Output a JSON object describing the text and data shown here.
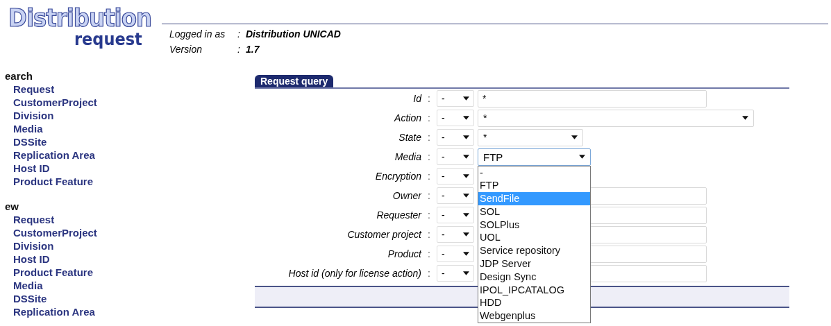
{
  "logo": {
    "title": "Distribution",
    "subtitle": "request"
  },
  "session": [
    {
      "label": "Logged in as",
      "separator": ":",
      "value": "Distribution UNICAD"
    },
    {
      "label": "Version",
      "separator": ":",
      "value": "1.7"
    }
  ],
  "sidebar": {
    "sections": [
      {
        "heading": "earch",
        "items": [
          "Request",
          "CustomerProject",
          "Division",
          "Media",
          "DSSite",
          "Replication Area",
          "Host ID",
          "Product Feature"
        ]
      },
      {
        "heading": "ew",
        "items": [
          "Request",
          "CustomerProject",
          "Division",
          "Host ID",
          "Product Feature",
          "Media",
          "DSSite",
          "Replication Area"
        ]
      }
    ]
  },
  "query": {
    "tab": "Request query",
    "rows": [
      {
        "label": "Id",
        "separator": ":",
        "operator": "-",
        "kind": "text",
        "value": "*"
      },
      {
        "label": "Action",
        "separator": ":",
        "operator": "-",
        "kind": "select",
        "value": "*"
      },
      {
        "label": "State",
        "separator": ":",
        "operator": "-",
        "kind": "select",
        "value": "*"
      },
      {
        "label": "Media",
        "separator": ":",
        "operator": "-",
        "kind": "select",
        "value": "FTP",
        "focused": true,
        "options": [
          {
            "label": "-",
            "highlighted": false
          },
          {
            "label": "FTP",
            "highlighted": false
          },
          {
            "label": "SendFile",
            "highlighted": true
          },
          {
            "label": "SOL",
            "highlighted": false
          },
          {
            "label": "SOLPlus",
            "highlighted": false
          },
          {
            "label": "UOL",
            "highlighted": false
          },
          {
            "label": "Service repository",
            "highlighted": false
          },
          {
            "label": "JDP Server",
            "highlighted": false
          },
          {
            "label": "Design Sync",
            "highlighted": false
          },
          {
            "label": "IPOL_IPCATALOG",
            "highlighted": false
          },
          {
            "label": "HDD",
            "highlighted": false
          },
          {
            "label": "Webgenplus",
            "highlighted": false
          }
        ]
      },
      {
        "label": "Encryption",
        "separator": ":",
        "operator": "-",
        "kind": "none"
      },
      {
        "label": "Owner",
        "separator": ":",
        "operator": "-",
        "kind": "text"
      },
      {
        "label": "Requester",
        "separator": ":",
        "operator": "-",
        "kind": "text"
      },
      {
        "label": "Customer project",
        "separator": ":",
        "operator": "-",
        "kind": "text"
      },
      {
        "label": "Product",
        "separator": ":",
        "operator": "-",
        "kind": "text"
      },
      {
        "label": "Host id (only for license action)",
        "separator": ":",
        "operator": "-",
        "kind": "text"
      }
    ]
  }
}
